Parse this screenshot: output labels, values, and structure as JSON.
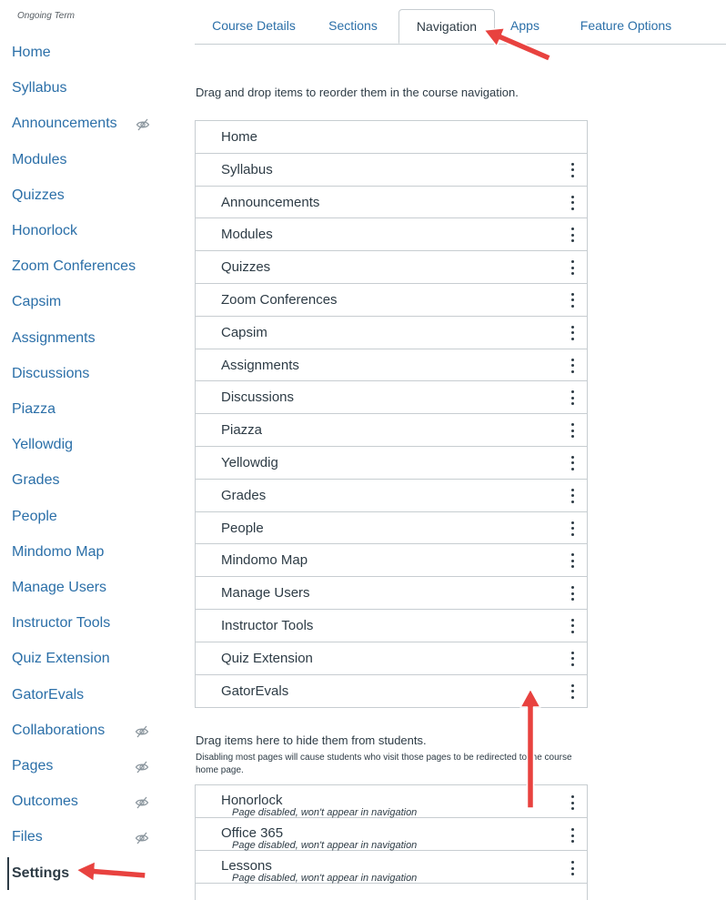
{
  "course_nav": {
    "term": "Ongoing Term",
    "items": [
      {
        "label": "Home",
        "hidden": false
      },
      {
        "label": "Syllabus",
        "hidden": false
      },
      {
        "label": "Announcements",
        "hidden": true
      },
      {
        "label": "Modules",
        "hidden": false
      },
      {
        "label": "Quizzes",
        "hidden": false
      },
      {
        "label": "Honorlock",
        "hidden": false
      },
      {
        "label": "Zoom Conferences",
        "hidden": false
      },
      {
        "label": "Capsim",
        "hidden": false
      },
      {
        "label": "Assignments",
        "hidden": false
      },
      {
        "label": "Discussions",
        "hidden": false
      },
      {
        "label": "Piazza",
        "hidden": false
      },
      {
        "label": "Yellowdig",
        "hidden": false
      },
      {
        "label": "Grades",
        "hidden": false
      },
      {
        "label": "People",
        "hidden": false
      },
      {
        "label": "Mindomo Map",
        "hidden": false
      },
      {
        "label": "Manage Users",
        "hidden": false
      },
      {
        "label": "Instructor Tools",
        "hidden": false
      },
      {
        "label": "Quiz Extension",
        "hidden": false
      },
      {
        "label": "GatorEvals",
        "hidden": false
      },
      {
        "label": "Collaborations",
        "hidden": true
      },
      {
        "label": "Pages",
        "hidden": true
      },
      {
        "label": "Outcomes",
        "hidden": true
      },
      {
        "label": "Files",
        "hidden": true
      },
      {
        "label": "Settings",
        "hidden": false,
        "active": true
      }
    ]
  },
  "tabs": [
    {
      "label": "Course Details"
    },
    {
      "label": "Sections"
    },
    {
      "label": "Navigation",
      "active": true
    },
    {
      "label": "Apps"
    },
    {
      "label": "Feature Options"
    }
  ],
  "navigation": {
    "instructions": "Drag and drop items to reorder them in the course navigation.",
    "enabled_items": [
      {
        "label": "Home",
        "menu": false
      },
      {
        "label": "Syllabus",
        "menu": true
      },
      {
        "label": "Announcements",
        "menu": true
      },
      {
        "label": "Modules",
        "menu": true
      },
      {
        "label": "Quizzes",
        "menu": true
      },
      {
        "label": "Zoom Conferences",
        "menu": true
      },
      {
        "label": "Capsim",
        "menu": true
      },
      {
        "label": "Assignments",
        "menu": true
      },
      {
        "label": "Discussions",
        "menu": true
      },
      {
        "label": "Piazza",
        "menu": true
      },
      {
        "label": "Yellowdig",
        "menu": true
      },
      {
        "label": "Grades",
        "menu": true
      },
      {
        "label": "People",
        "menu": true
      },
      {
        "label": "Mindomo Map",
        "menu": true
      },
      {
        "label": "Manage Users",
        "menu": true
      },
      {
        "label": "Instructor Tools",
        "menu": true
      },
      {
        "label": "Quiz Extension",
        "menu": true
      },
      {
        "label": "GatorEvals",
        "menu": true
      }
    ],
    "hide_heading": "Drag items here to hide them from students.",
    "hide_note": "Disabling most pages will cause students who visit those pages to be redirected to the course home page.",
    "disabled_items": [
      {
        "label": "Honorlock",
        "note": "Page disabled, won't appear in navigation"
      },
      {
        "label": "Office 365",
        "note": "Page disabled, won't appear in navigation"
      },
      {
        "label": "Lessons",
        "note": "Page disabled, won't appear in navigation"
      }
    ]
  },
  "colors": {
    "link": "#2b6fa8",
    "text": "#2d3b45",
    "border": "#c7cdd1",
    "annotation_arrow": "#e8423f"
  },
  "icons": {
    "hidden": "eye-slash-icon",
    "row_menu": "kebab-menu-icon",
    "annotation": "red-arrow"
  }
}
